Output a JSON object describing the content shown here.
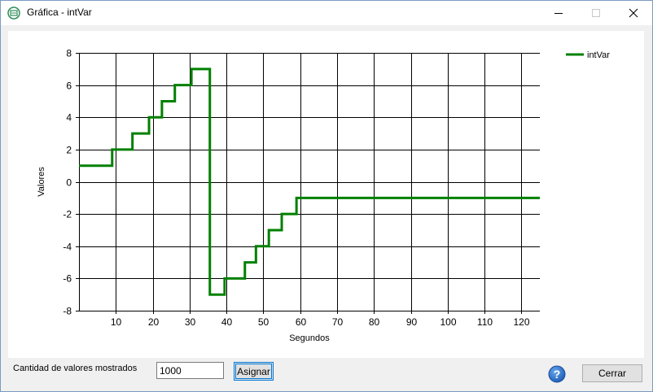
{
  "window": {
    "title": "Gráfica - intVar",
    "minimize_icon": "minimize-icon",
    "maximize_icon": "maximize-icon",
    "close_icon": "close-icon"
  },
  "controls": {
    "quantity_label": "Cantidad de valores mostrados",
    "quantity_value": "1000",
    "assign_label": "Asignar",
    "close_label": "Cerrar",
    "help_icon": "help-icon"
  },
  "colors": {
    "series": "#008000",
    "grid": "#000000"
  },
  "chart_data": {
    "type": "line",
    "title": "",
    "xlabel": "Segundos",
    "ylabel": "Valores",
    "xlim": [
      0,
      125
    ],
    "ylim": [
      -8,
      8
    ],
    "x_ticks": [
      10,
      20,
      30,
      40,
      50,
      60,
      70,
      80,
      90,
      100,
      110,
      120
    ],
    "y_ticks": [
      8,
      6,
      4,
      2,
      0,
      -2,
      -4,
      -6,
      -8
    ],
    "grid": true,
    "legend_position": "top-right",
    "series": [
      {
        "name": "intVar",
        "step": true,
        "x": [
          0,
          9,
          14.5,
          19,
          22.5,
          26,
          30.5,
          35.5,
          39.5,
          45,
          48,
          51.5,
          55,
          59,
          125
        ],
        "y": [
          1,
          2,
          3,
          4,
          5,
          6,
          7,
          -7,
          -6,
          -5,
          -4,
          -3,
          -2,
          -1,
          -1
        ]
      }
    ]
  }
}
